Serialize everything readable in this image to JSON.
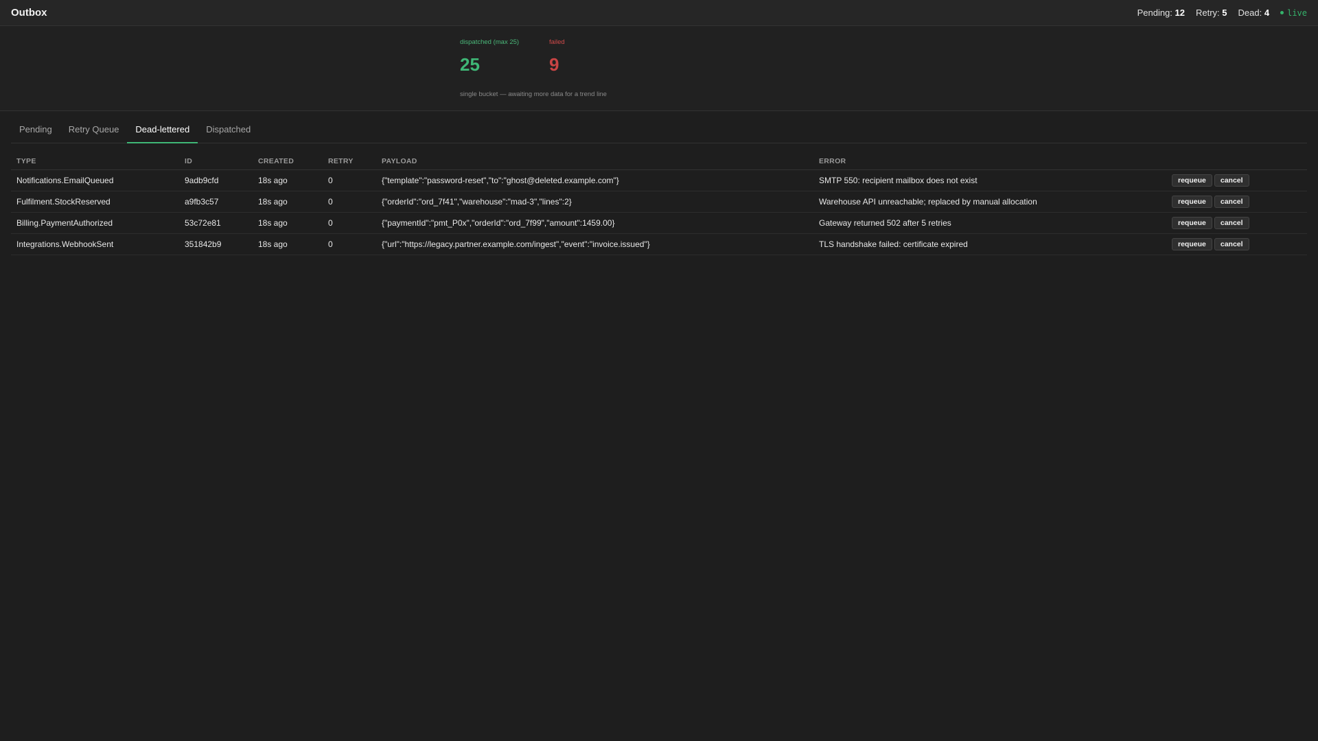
{
  "app": {
    "title": "Outbox"
  },
  "counters": {
    "pending_label": "Pending:",
    "pending_value": "12",
    "retry_label": "Retry:",
    "retry_value": "5",
    "dead_label": "Dead:",
    "dead_value": "4",
    "live_label": "live"
  },
  "stats": {
    "dispatched_label": "dispatched (max 25)",
    "dispatched_value": "25",
    "failed_label": "failed",
    "failed_value": "9",
    "note": "single bucket — awaiting more data for a trend line"
  },
  "tabs": [
    {
      "label": "Pending",
      "active": false
    },
    {
      "label": "Retry Queue",
      "active": false
    },
    {
      "label": "Dead-lettered",
      "active": true
    },
    {
      "label": "Dispatched",
      "active": false
    }
  ],
  "table": {
    "columns": [
      "TYPE",
      "ID",
      "CREATED",
      "RETRY",
      "PAYLOAD",
      "ERROR"
    ],
    "rows": [
      {
        "type": "Notifications.EmailQueued",
        "id": "9adb9cfd",
        "created": "18s ago",
        "retry": "0",
        "payload": "{\"template\":\"password-reset\",\"to\":\"ghost@deleted.example.com\"}",
        "error": "SMTP 550: recipient mailbox does not exist",
        "requeue": "requeue",
        "cancel": "cancel"
      },
      {
        "type": "Fulfilment.StockReserved",
        "id": "a9fb3c57",
        "created": "18s ago",
        "retry": "0",
        "payload": "{\"orderId\":\"ord_7f41\",\"warehouse\":\"mad-3\",\"lines\":2}",
        "error": "Warehouse API unreachable; replaced by manual allocation",
        "requeue": "requeue",
        "cancel": "cancel"
      },
      {
        "type": "Billing.PaymentAuthorized",
        "id": "53c72e81",
        "created": "18s ago",
        "retry": "0",
        "payload": "{\"paymentId\":\"pmt_P0x\",\"orderId\":\"ord_7f99\",\"amount\":1459.00}",
        "error": "Gateway returned 502 after 5 retries",
        "requeue": "requeue",
        "cancel": "cancel"
      },
      {
        "type": "Integrations.WebhookSent",
        "id": "351842b9",
        "created": "18s ago",
        "retry": "0",
        "payload": "{\"url\":\"https://legacy.partner.example.com/ingest\",\"event\":\"invoice.issued\"}",
        "error": "TLS handshake failed: certificate expired",
        "requeue": "requeue",
        "cancel": "cancel"
      }
    ]
  },
  "colors": {
    "accent": "#3fb776",
    "failed": "#c94444",
    "background": "#1e1e1e"
  }
}
